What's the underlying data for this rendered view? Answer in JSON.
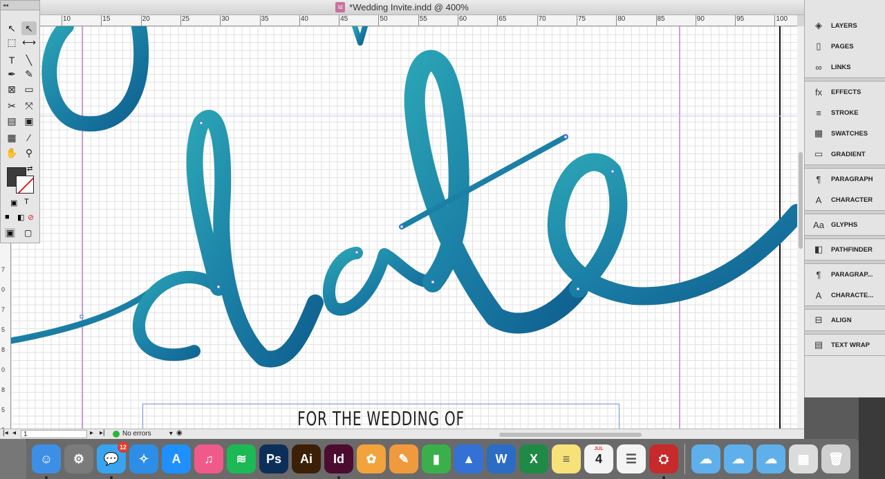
{
  "window": {
    "title": "*Wedding Invite.indd @ 400%"
  },
  "ruler_top": {
    "ticks": [
      "10",
      "15",
      "20",
      "25",
      "30",
      "35",
      "40",
      "45",
      "50",
      "55",
      "60",
      "65",
      "70",
      "75",
      "80",
      "85",
      "90",
      "95",
      "100"
    ]
  },
  "ruler_left": {
    "ticks": [
      "7",
      "0",
      "7",
      "5",
      "8",
      "0",
      "8",
      "5",
      "9"
    ]
  },
  "document": {
    "frame_text": "FOR THE WEDDING OF",
    "script_color": "#1f8aa8"
  },
  "tools": {
    "header": "◂◂",
    "items": [
      {
        "name": "selection-tool",
        "glyph": "↖"
      },
      {
        "name": "direct-selection-tool",
        "glyph": "↖"
      },
      {
        "name": "page-tool",
        "glyph": "⬚"
      },
      {
        "name": "gap-tool",
        "glyph": "⟷"
      },
      {
        "name": "type-tool",
        "glyph": "T"
      },
      {
        "name": "line-tool",
        "glyph": "╲"
      },
      {
        "name": "pen-tool",
        "glyph": "✒"
      },
      {
        "name": "pencil-tool",
        "glyph": "✎"
      },
      {
        "name": "rectangle-frame-tool",
        "glyph": "⊠"
      },
      {
        "name": "rectangle-tool",
        "glyph": "▭"
      },
      {
        "name": "scissors-tool",
        "glyph": "✂"
      },
      {
        "name": "free-transform-tool",
        "glyph": "⤧"
      },
      {
        "name": "gradient-swatch-tool",
        "glyph": "▤"
      },
      {
        "name": "content-collector-tool",
        "glyph": "▣"
      },
      {
        "name": "note-tool",
        "glyph": "▦"
      },
      {
        "name": "eyedropper-tool",
        "glyph": "⁄"
      },
      {
        "name": "hand-tool",
        "glyph": "✋"
      },
      {
        "name": "zoom-tool",
        "glyph": "⚲"
      }
    ],
    "format_text": "T"
  },
  "status": {
    "page": "1",
    "preflight": "No errors"
  },
  "panels": {
    "groups": [
      [
        "LAYERS",
        "PAGES",
        "LINKS"
      ],
      [
        "EFFECTS",
        "STROKE",
        "SWATCHES",
        "GRADIENT"
      ],
      [
        "PARAGRAPH",
        "CHARACTER"
      ],
      [
        "GLYPHS"
      ],
      [
        "PATHFINDER"
      ],
      [
        "PARAGRAP...",
        "CHARACTE..."
      ],
      [
        "ALIGN"
      ],
      [
        "TEXT WRAP"
      ]
    ],
    "icons": {
      "LAYERS": "◈",
      "PAGES": "▯",
      "LINKS": "∞",
      "EFFECTS": "fx",
      "STROKE": "≡",
      "SWATCHES": "▦",
      "GRADIENT": "▭",
      "PARAGRAPH": "¶",
      "CHARACTER": "A",
      "GLYPHS": "Aa",
      "PATHFINDER": "◧",
      "PARAGRAP...": "¶",
      "CHARACTE...": "A",
      "ALIGN": "⊟",
      "TEXT WRAP": "▤"
    }
  },
  "dock": {
    "apps": [
      {
        "name": "finder",
        "label": "☺",
        "color": "#3d8fe6",
        "running": true
      },
      {
        "name": "system-preferences",
        "label": "⚙",
        "color": "#7b7b7b",
        "running": false
      },
      {
        "name": "messages",
        "label": "💬",
        "color": "#38a4f0",
        "running": true,
        "badge": "12"
      },
      {
        "name": "safari",
        "label": "✧",
        "color": "#2d8ee8",
        "running": false
      },
      {
        "name": "app-store",
        "label": "A",
        "color": "#1e90ff",
        "running": false
      },
      {
        "name": "itunes",
        "label": "♫",
        "color": "#f05a8a",
        "running": false
      },
      {
        "name": "spotify",
        "label": "≋",
        "color": "#1db954",
        "running": false
      },
      {
        "name": "photoshop",
        "label": "Ps",
        "color": "#0c2f5a",
        "running": false
      },
      {
        "name": "illustrator",
        "label": "Ai",
        "color": "#3b1f07",
        "running": false
      },
      {
        "name": "indesign",
        "label": "Id",
        "color": "#4b0c2f",
        "running": true
      },
      {
        "name": "photos",
        "label": "✿",
        "color": "#f2a33c",
        "running": false
      },
      {
        "name": "pages",
        "label": "✎",
        "color": "#f09a3e",
        "running": false
      },
      {
        "name": "numbers",
        "label": "▮",
        "color": "#3bb04a",
        "running": false
      },
      {
        "name": "keynote",
        "label": "▲",
        "color": "#3471d6",
        "running": false
      },
      {
        "name": "word",
        "label": "W",
        "color": "#2b6cc4",
        "running": false
      },
      {
        "name": "excel",
        "label": "X",
        "color": "#1f8a45",
        "running": false
      },
      {
        "name": "notes",
        "label": "≡",
        "color": "#f7e27a",
        "running": false
      },
      {
        "name": "calendar",
        "label": "4",
        "color": "#f4f4f4",
        "running": false
      },
      {
        "name": "reminders",
        "label": "☰",
        "color": "#f4f4f4",
        "running": false
      },
      {
        "name": "acrobat",
        "label": "⛭",
        "color": "#c62a2a",
        "running": true
      }
    ],
    "calendar_month": "JUL",
    "folders": [
      {
        "name": "icloud-drive-folder-1",
        "label": "☁",
        "color": "#5fb0ea"
      },
      {
        "name": "icloud-drive-folder-2",
        "label": "☁",
        "color": "#5fb0ea"
      },
      {
        "name": "icloud-drive-folder-3",
        "label": "☁",
        "color": "#5fb0ea"
      },
      {
        "name": "downloads-stack",
        "label": "▦",
        "color": "#dcdcdc"
      },
      {
        "name": "trash",
        "label": "🗑",
        "color": "#cfcfcf"
      }
    ]
  }
}
